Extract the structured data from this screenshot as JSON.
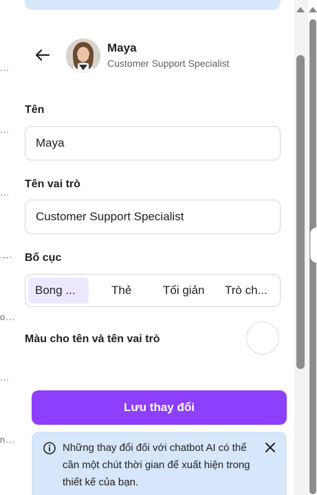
{
  "header": {
    "back_icon": "arrow-left-icon",
    "agent_name": "Maya",
    "agent_role": "Customer Support Specialist"
  },
  "form": {
    "name_label": "Tên",
    "name_value": "Maya",
    "role_label": "Tên vai trò",
    "role_value": "Customer Support Specialist",
    "layout_label": "Bố cục",
    "layout_options": [
      {
        "label": "Bong ...",
        "selected": true
      },
      {
        "label": "Thẻ",
        "selected": false
      },
      {
        "label": "Tối giản",
        "selected": false
      },
      {
        "label": "Trò ch...",
        "selected": false
      }
    ],
    "color_label": "Màu cho tên và tên vai trò",
    "color_value": "#ffffff"
  },
  "actions": {
    "save_label": "Lưu thay đổi"
  },
  "notice": {
    "icon": "info-icon",
    "text": "Những thay đổi đối với chatbot AI có thể cần một chút thời gian để xuất hiện trong thiết kế của bạn.",
    "close_icon": "close-icon"
  },
  "background_list": {
    "truncated": [
      "...",
      "...",
      "...",
      "...",
      "...",
      "o...",
      "...",
      "...",
      "...",
      "n..."
    ]
  },
  "colors": {
    "accent": "#8c3ffd",
    "notice_bg": "#d6e6fb",
    "selected_option_bg": "#eee8ff"
  }
}
